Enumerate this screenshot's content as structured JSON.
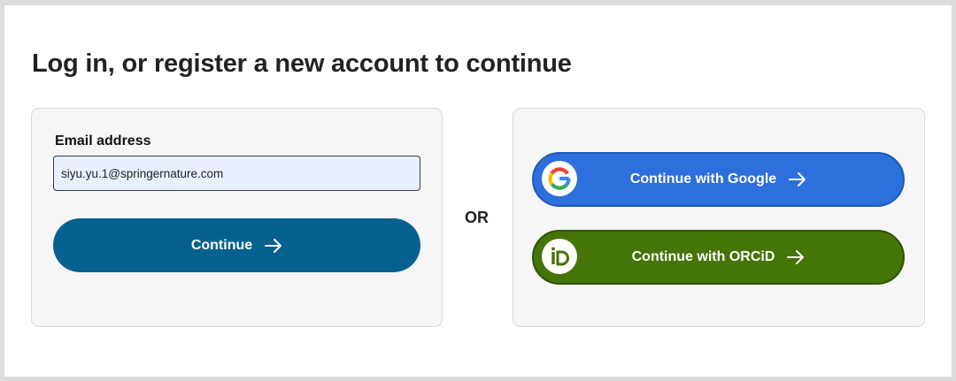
{
  "page": {
    "title": "Log in, or register a new account to continue"
  },
  "email_panel": {
    "label": "Email address",
    "value": "siyu.yu.1@springernature.com",
    "continue_label": "Continue"
  },
  "separator": "OR",
  "social_panel": {
    "google_label": "Continue with Google",
    "orcid_label": "Continue with ORCiD"
  },
  "colors": {
    "primary": "#05618e",
    "google": "#2d6fdd",
    "orcid": "#457407"
  },
  "icons": [
    "arrow-right-icon",
    "google-logo-icon",
    "orcid-logo-icon"
  ]
}
